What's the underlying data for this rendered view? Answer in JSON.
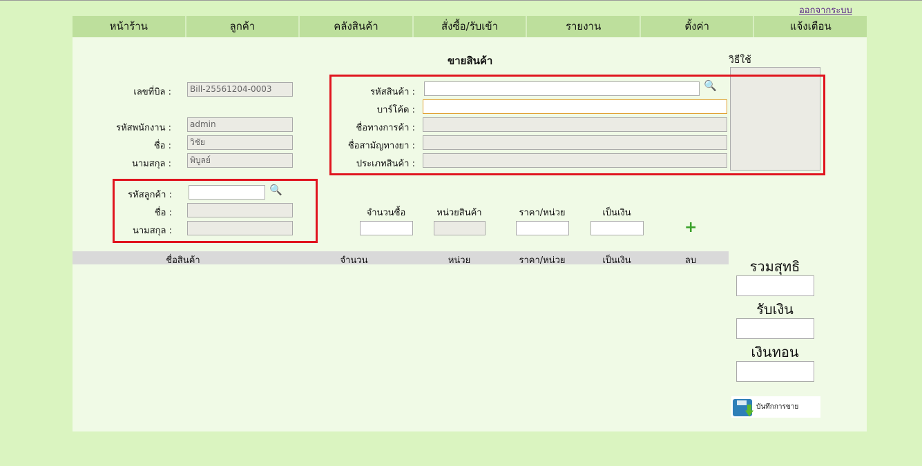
{
  "logout": "ออกจากระบบ",
  "nav": [
    "หน้าร้าน",
    "ลูกค้า",
    "คลังสินค้า",
    "สั่งซื้อ/รับเข้า",
    "รายงาน",
    "ตั้งค่า",
    "แจ้งเตือน"
  ],
  "title": "ขายสินค้า",
  "howto": "วิธีใช้",
  "bill": {
    "label": "เลขที่บิล :",
    "value": "Bill-25561204-0003"
  },
  "employee": {
    "id_label": "รหัสพนักงาน :",
    "id": "admin",
    "name_label": "ชื่อ :",
    "name": "วิชัย",
    "surname_label": "นามสกุล :",
    "surname": "พิบูลย์"
  },
  "customer": {
    "id_label": "รหัสลูกค้า :",
    "name_label": "ชื่อ :",
    "surname_label": "นามสกุล :"
  },
  "product": {
    "code": "รหัสสินค้า :",
    "barcode": "บาร์โค้ด :",
    "trade": "ชื่อทางการค้า :",
    "generic": "ชื่อสามัญทางยา :",
    "type": "ประเภทสินค้า :"
  },
  "entry": {
    "qty": "จำนวนซื้อ",
    "unit": "หน่วยสินค้า",
    "price": "ราคา/หน่วย",
    "amount": "เป็นเงิน"
  },
  "table": [
    "ชื่อสินค้า",
    "จำนวน",
    "หน่วย",
    "ราคา/หน่วย",
    "เป็นเงิน",
    "ลบ"
  ],
  "totals": {
    "net": "รวมสุทธิ",
    "received": "รับเงิน",
    "change": "เงินทอน"
  },
  "save": "บันทึกการขาย"
}
